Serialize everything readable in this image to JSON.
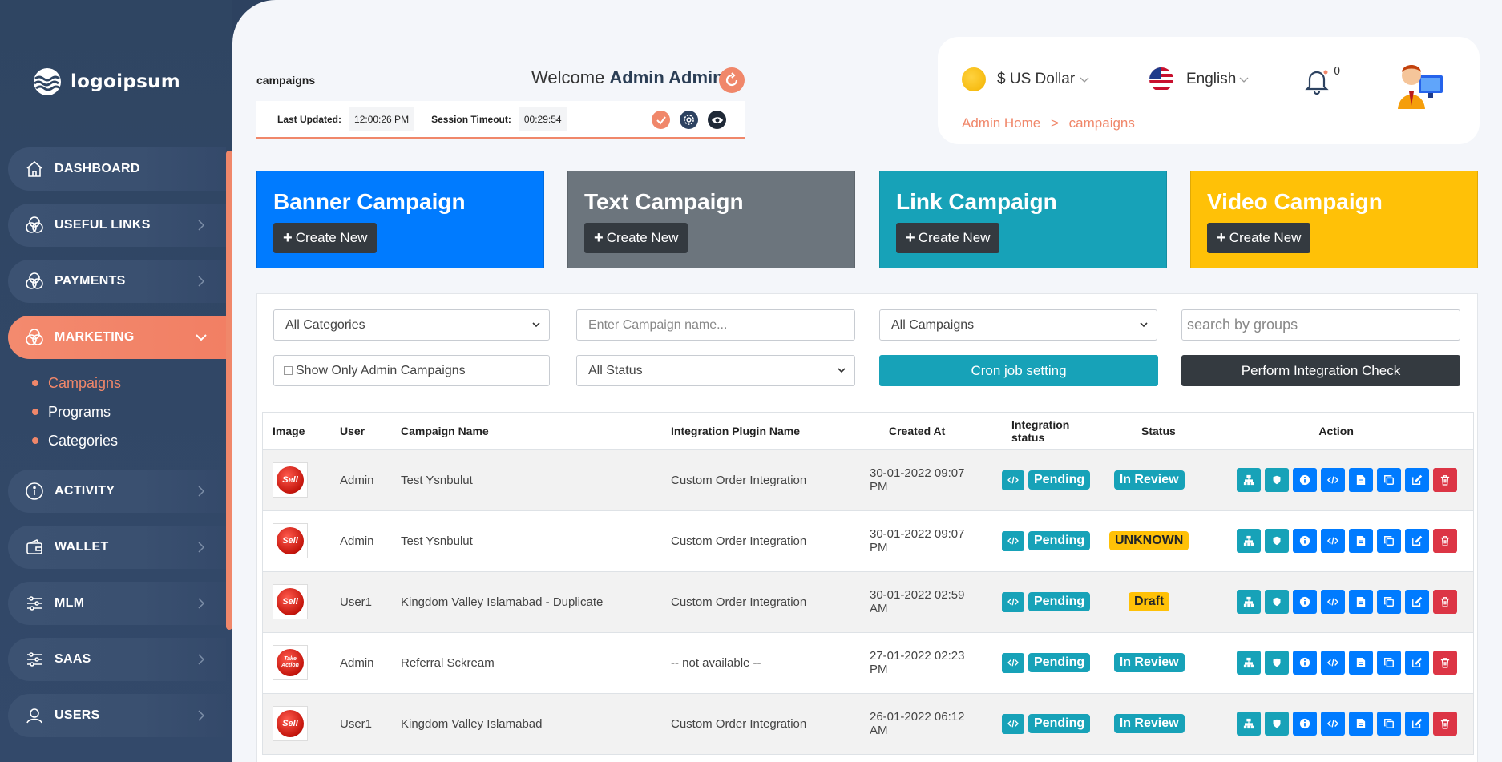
{
  "brand": {
    "logo_text": "logoipsum"
  },
  "sidebar": {
    "items": [
      {
        "label": "DASHBOARD",
        "icon": "home-icon"
      },
      {
        "label": "USEFUL LINKS",
        "icon": "rings-icon"
      },
      {
        "label": "PAYMENTS",
        "icon": "rings-icon"
      },
      {
        "label": "MARKETING",
        "icon": "rings-icon",
        "active": true
      },
      {
        "label": "ACTIVITY",
        "icon": "info-icon"
      },
      {
        "label": "WALLET",
        "icon": "wallet-icon"
      },
      {
        "label": "MLM",
        "icon": "sliders-icon"
      },
      {
        "label": "SAAS",
        "icon": "sliders-icon"
      },
      {
        "label": "USERS",
        "icon": "user-icon"
      }
    ],
    "marketing_sub": [
      "Campaigns",
      "Programs",
      "Categories"
    ]
  },
  "header": {
    "page_title": "campaigns",
    "welcome_prefix": "Welcome",
    "welcome_name": "Admin Admin",
    "last_updated_label": "Last Updated:",
    "last_updated_value": "12:00:26 PM",
    "session_timeout_label": "Session Timeout:",
    "session_timeout_value": "00:29:54"
  },
  "topbar": {
    "currency": "$ US Dollar",
    "language": "English",
    "notifications": "0",
    "breadcrumb_home": "Admin Home",
    "breadcrumb_sep": ">",
    "breadcrumb_current": "campaigns"
  },
  "cards": [
    {
      "title": "Banner Campaign",
      "button": "Create New",
      "color": "#007bff"
    },
    {
      "title": "Text Campaign",
      "button": "Create New",
      "color": "#6c757d"
    },
    {
      "title": "Link Campaign",
      "button": "Create New",
      "color": "#17a2b8"
    },
    {
      "title": "Video Campaign",
      "button": "Create New",
      "color": "#ffc107"
    }
  ],
  "filters": {
    "category": "All Categories",
    "campaign_name_placeholder": "Enter Campaign name...",
    "campaigns": "All Campaigns",
    "groups_placeholder": "search by groups",
    "admin_only": "Show Only Admin Campaigns",
    "status": "All Status",
    "cron_button": "Cron job setting",
    "integration_button": "Perform Integration Check"
  },
  "table": {
    "headers": [
      "Image",
      "User",
      "Campaign Name",
      "Integration Plugin Name",
      "Created At",
      "Integration status",
      "Status",
      "Action"
    ],
    "rows": [
      {
        "user": "Admin",
        "name": "Test Ysnbulut",
        "plugin": "Custom Order Integration",
        "created": "30-01-2022 09:07 PM",
        "integration": "Pending",
        "status": "In Review",
        "status_style": "info",
        "thumb": "Sell"
      },
      {
        "user": "Admin",
        "name": "Test Ysnbulut",
        "plugin": "Custom Order Integration",
        "created": "30-01-2022 09:07 PM",
        "integration": "Pending",
        "status": "UNKNOWN",
        "status_style": "warn",
        "thumb": "Sell"
      },
      {
        "user": "User1",
        "name": "Kingdom Valley Islamabad - Duplicate",
        "plugin": "Custom Order Integration",
        "created": "30-01-2022 02:59 AM",
        "integration": "Pending",
        "status": "Draft",
        "status_style": "warn",
        "thumb": "Sell"
      },
      {
        "user": "Admin",
        "name": "Referral Sckream",
        "plugin": "-- not available --",
        "created": "27-01-2022 02:23 PM",
        "integration": "Pending",
        "status": "In Review",
        "status_style": "info",
        "thumb": "Take Action"
      },
      {
        "user": "User1",
        "name": "Kingdom Valley Islamabad",
        "plugin": "Custom Order Integration",
        "created": "26-01-2022 06:12 AM",
        "integration": "Pending",
        "status": "In Review",
        "status_style": "info",
        "thumb": "Sell"
      }
    ]
  },
  "colors": {
    "accent": "#f0876a",
    "sidebar": "#2f4562",
    "teal": "#17a2b8",
    "blue": "#007bff",
    "red": "#dc3545"
  }
}
